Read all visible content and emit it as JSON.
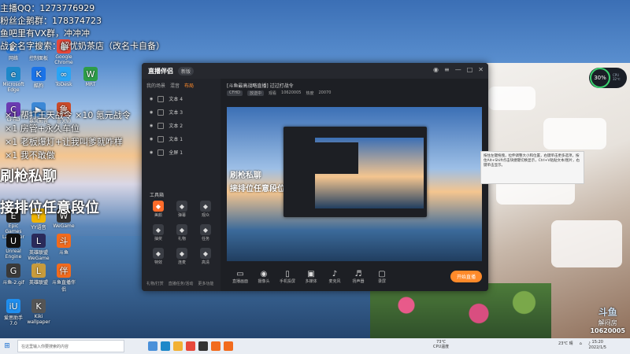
{
  "overlay": {
    "lines_top": [
      "主播QQ：1273776929",
      "粉丝企鹅群：178374723",
      "鱼吧里有VX群，冲冲冲",
      "战令名字搜索：解忧奶茶店（改名卡自备）"
    ],
    "lines_mid": [
      "×1 帮打王天战令 ×10 氪元战令",
      "×1 房管+永久车位",
      "×1 老板爆灯+让我叫爹就咋样",
      "×1 我不敢做"
    ],
    "big1": "刷枪私聊",
    "big2": "接排位任意段位"
  },
  "desktop": {
    "icons": [
      {
        "label": "网络",
        "color": "#2b7bd8",
        "glyph": "◧"
      },
      {
        "label": "控制面板",
        "color": "#4a90d9",
        "glyph": "⚙"
      },
      {
        "label": "Google Chrome",
        "color": "#e7483b",
        "glyph": "●"
      },
      {
        "label": "Microsoft Edge",
        "color": "#1e88c9",
        "glyph": "e"
      },
      {
        "label": "酷狗",
        "color": "#1a73e8",
        "glyph": "K"
      },
      {
        "label": "ToDesk",
        "color": "#2aa4f4",
        "glyph": "∞"
      },
      {
        "label": "MRT",
        "color": "#2e9d48",
        "glyph": "W"
      },
      {
        "label": "CFHD",
        "color": "#6b3bb2",
        "glyph": "C"
      },
      {
        "label": "暴风影音",
        "color": "#3c88d6",
        "glyph": "▶"
      },
      {
        "label": "鲁大师",
        "color": "#c94a2a",
        "glyph": "鲁"
      },
      {
        "label": "Epic Games Launcher",
        "color": "#222",
        "glyph": "E"
      },
      {
        "label": "YY语音",
        "color": "#f0b400",
        "glyph": "Y"
      },
      {
        "label": "WeGame",
        "color": "#333",
        "glyph": "W"
      },
      {
        "label": "Unreal Engine",
        "color": "#111",
        "glyph": "U"
      },
      {
        "label": "英雄联盟 WeGame版",
        "color": "#2a2a5a",
        "glyph": "L"
      },
      {
        "label": "斗鱼",
        "color": "#f26b1d",
        "glyph": "斗"
      },
      {
        "label": "斗鱼-2.gif",
        "color": "#3a3a3a",
        "glyph": "G"
      },
      {
        "label": "英雄联盟",
        "color": "#c89b3c",
        "glyph": "L"
      },
      {
        "label": "斗鱼直播伴侣",
        "color": "#f26b1d",
        "glyph": "伴"
      },
      {
        "label": "爱思助手7.0",
        "color": "#1f8ff0",
        "glyph": "iU"
      },
      {
        "label": "Kiki wallpaper",
        "color": "#555",
        "glyph": "K"
      }
    ]
  },
  "app": {
    "logo": "直播伴侣",
    "version": "新版",
    "tabs": [
      "我的场景",
      "混音",
      "布局"
    ],
    "active_tab": "布局",
    "scenes": [
      "文本 4",
      "文本 3",
      "文本 2",
      "文本 1",
      "全屏 1"
    ],
    "tools_title": "工具箱",
    "tools": [
      "美颜",
      "弹幕",
      "观众",
      "抽奖",
      "礼物",
      "任务",
      "特效",
      "连麦",
      "高清"
    ],
    "sidebar_bottom": [
      "礼物/打赏",
      "直播任务/活动",
      "更多功能"
    ],
    "live_title": "[斗鱼最高战略直播] 过过打战令",
    "live_meta": [
      "CFHD",
      "放送中",
      "观看",
      "10620005",
      "热度",
      "20070"
    ],
    "preview_big1": "刷枪私聊",
    "preview_big2": "接排位任意段位",
    "bottom_items": [
      {
        "label": "直播画面",
        "glyph": "▭"
      },
      {
        "label": "摄像头",
        "glyph": "◉"
      },
      {
        "label": "手机投屏",
        "glyph": "▯"
      },
      {
        "label": "多媒体",
        "glyph": "▣"
      },
      {
        "label": "麦克风",
        "glyph": "♪"
      },
      {
        "label": "扬声器",
        "glyph": "♬"
      },
      {
        "label": "录屏",
        "glyph": "▢"
      }
    ],
    "start_btn": "开始直播"
  },
  "tooltip": "按住左键拖拽，拉伸调整大小和位置，右键单击更多选项，按住Alt+Shift点击快捷键切换显示，Ctrl+V粘贴文本/图片，右键单击显示。",
  "cpu": {
    "percent": "30%",
    "info1": "CPU",
    "info2": "32℃"
  },
  "taskbar": {
    "search": "在这里输入你要搜索的内容",
    "weather_temp": "73℃",
    "weather_label": "CPU温度",
    "tray_temp": "23℃ 晴",
    "time": "15:20",
    "date": "2022/1/5"
  },
  "watermark": {
    "logo": "斗鱼",
    "name": "解闷房",
    "id": "10620005"
  }
}
